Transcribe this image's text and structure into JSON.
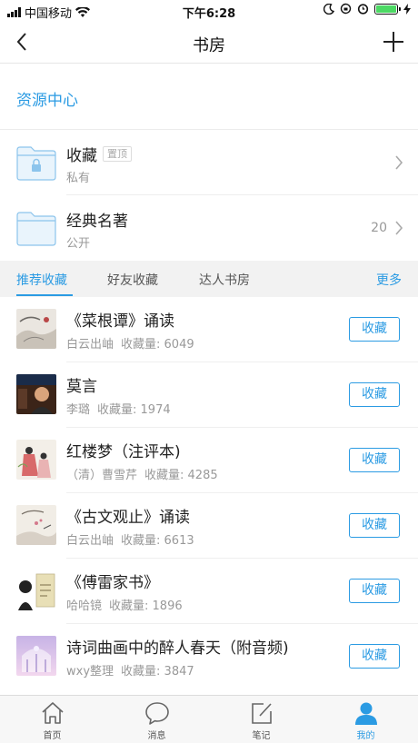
{
  "status_bar": {
    "carrier": "中国移动",
    "time": "下午6:28",
    "battery_color": "#4cd964"
  },
  "nav": {
    "title": "书房",
    "back_icon": "chevron-left-icon",
    "add_icon": "plus-icon"
  },
  "resource_center": "资源中心",
  "folders": [
    {
      "name": "收藏",
      "badge": "置顶",
      "sub": "私有",
      "count": "",
      "icon": "locked-folder-icon"
    },
    {
      "name": "经典名著",
      "badge": "",
      "sub": "公开",
      "count": "20",
      "icon": "folder-icon"
    }
  ],
  "tabs": {
    "items": [
      "推荐收藏",
      "好友收藏",
      "达人书房"
    ],
    "active_index": 0,
    "more": "更多"
  },
  "books": [
    {
      "title": "《菜根谭》诵读",
      "author": "白云出岫",
      "count": "收藏量: 6049",
      "button": "收藏"
    },
    {
      "title": "莫言",
      "author": "李璐",
      "count": "收藏量: 1974",
      "button": "收藏"
    },
    {
      "title": "红楼梦（注评本)",
      "author": "（清）曹雪芹",
      "count": "收藏量: 4285",
      "button": "收藏"
    },
    {
      "title": "《古文观止》诵读",
      "author": "白云出岫",
      "count": "收藏量: 6613",
      "button": "收藏"
    },
    {
      "title": "《傅雷家书》",
      "author": "哈哈镜",
      "count": "收藏量: 1896",
      "button": "收藏"
    },
    {
      "title": "诗词曲画中的醉人春天（附音频)",
      "author": "wxy整理",
      "count": "收藏量: 3847",
      "button": "收藏"
    }
  ],
  "tabbar": [
    {
      "label": "首页",
      "icon": "home-icon"
    },
    {
      "label": "消息",
      "icon": "message-icon"
    },
    {
      "label": "笔记",
      "icon": "note-icon"
    },
    {
      "label": "我的",
      "icon": "user-icon"
    }
  ],
  "tabbar_active_index": 3,
  "colors": {
    "accent": "#2b9be3",
    "tab_bg": "#f2f2f2",
    "muted_text": "#999999"
  }
}
